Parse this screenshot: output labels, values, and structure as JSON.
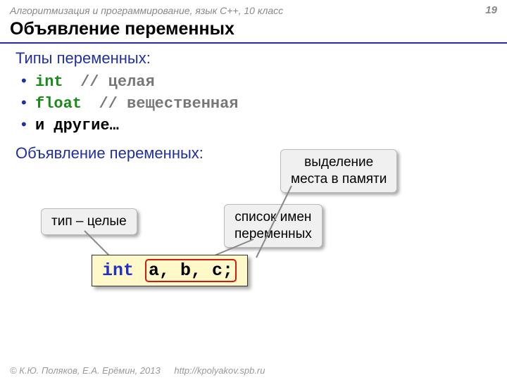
{
  "header": {
    "course": "Алгоритмизация и программирование, язык  C++, 10 класс",
    "page": "19"
  },
  "title": "Объявление  переменных",
  "section1": {
    "heading": "Типы переменных:",
    "items": [
      {
        "kw": "int",
        "comment": "// целая"
      },
      {
        "kw": "float",
        "comment": "// вещественная"
      },
      {
        "kw": "",
        "comment": "и другие…"
      }
    ]
  },
  "section2": {
    "heading": "Объявление переменных:"
  },
  "callouts": {
    "type": "тип – целые",
    "names": "список имен\nпеременных",
    "memory": "выделение\nместа в памяти"
  },
  "code": {
    "kw": "int",
    "vars": "a, b, c;"
  },
  "footer": {
    "copyright": "© К.Ю. Поляков, Е.А. Ерёмин, 2013",
    "url": "http://kpolyakov.spb.ru"
  }
}
